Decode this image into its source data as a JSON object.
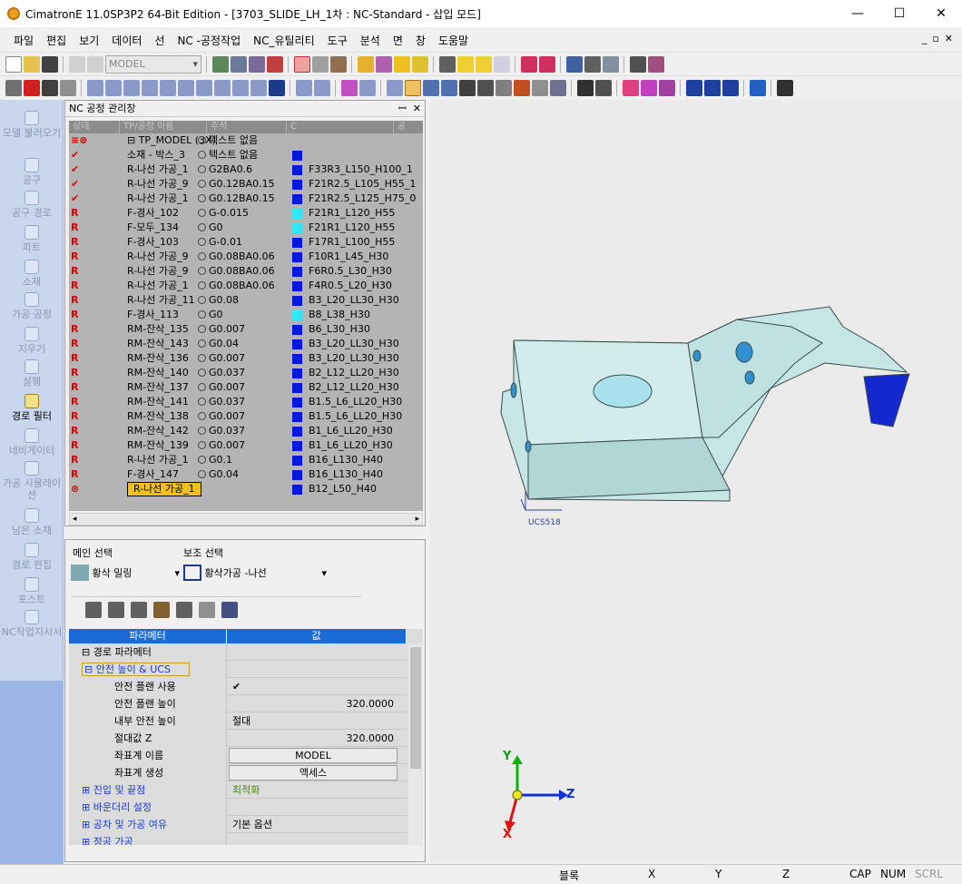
{
  "window": {
    "title": "CimatronE 11.0SP3P2 64-Bit Edition - [3703_SLIDE_LH_1차 : NC-Standard - 삽입 모드]",
    "controls": [
      "—",
      "☐",
      "✕"
    ]
  },
  "menu": [
    "파일",
    "편집",
    "보기",
    "데이터",
    "선",
    "NC -공정작업",
    "NC_유틸리티",
    "도구",
    "분석",
    "면",
    "창",
    "도움말"
  ],
  "mdi_controls": [
    "_",
    "▫",
    "✕"
  ],
  "toolbar": {
    "model_combo": "MODEL"
  },
  "sidebar": [
    {
      "label": "모델 불러오기",
      "active": false
    },
    {
      "label": "공구",
      "active": false
    },
    {
      "label": "공구 경로",
      "active": false
    },
    {
      "label": "파트",
      "active": false
    },
    {
      "label": "소재",
      "active": false
    },
    {
      "label": "가공 공정",
      "active": false
    },
    {
      "label": "지우기",
      "active": false
    },
    {
      "label": "실행",
      "active": false
    },
    {
      "label": "경로 필터",
      "active": true
    },
    {
      "label": "네비게이터",
      "active": false
    },
    {
      "label": "가공 시뮬레이션",
      "active": false
    },
    {
      "label": "남은 소재",
      "active": false
    },
    {
      "label": "경로 편집",
      "active": false
    },
    {
      "label": "포스트",
      "active": false
    },
    {
      "label": "NC작업지시서",
      "active": false
    }
  ],
  "nc_panel": {
    "title": "NC 공정 관리창",
    "pin": "ꟷ",
    "close": "✕",
    "columns": [
      "상태",
      "TP/공정 이름",
      "주석",
      "C",
      "공"
    ],
    "rows": [
      {
        "status": "≡⊗",
        "name": "⊟ TP_MODEL (3X)",
        "value": "텍스트 없음",
        "color": "",
        "tool": ""
      },
      {
        "status": "✔",
        "name": "소재 - 박스_3",
        "value": "텍스트 없음",
        "color": "blue",
        "tool": ""
      },
      {
        "status": "✔",
        "name": "R-나선 가공_1",
        "value": "G2BA0.6",
        "color": "blue",
        "tool": "F33R3_L150_H100_1"
      },
      {
        "status": "✔",
        "name": "R-나선 가공_9",
        "value": "G0.12BA0.15",
        "color": "blue",
        "tool": "F21R2.5_L105_H55_1"
      },
      {
        "status": "✔",
        "name": "R-나선 가공_1",
        "value": "G0.12BA0.15",
        "color": "blue",
        "tool": "F21R2.5_L125_H75_0"
      },
      {
        "status": "R",
        "name": "F-경사_102",
        "value": "G-0.015",
        "color": "cyan",
        "tool": "F21R1_L120_H55"
      },
      {
        "status": "R",
        "name": "F-모두_134",
        "value": "G0",
        "color": "cyan",
        "tool": "F21R1_L120_H55"
      },
      {
        "status": "R",
        "name": "F-경사_103",
        "value": "G-0.01",
        "color": "blue",
        "tool": "F17R1_L100_H55"
      },
      {
        "status": "R",
        "name": "R-나선 가공_9",
        "value": "G0.08BA0.06",
        "color": "blue",
        "tool": "F10R1_L45_H30"
      },
      {
        "status": "R",
        "name": "R-나선 가공_9",
        "value": "G0.08BA0.06",
        "color": "blue",
        "tool": "F6R0.5_L30_H30"
      },
      {
        "status": "R",
        "name": "R-나선 가공_1",
        "value": "G0.08BA0.06",
        "color": "blue",
        "tool": "F4R0.5_L20_H30"
      },
      {
        "status": "R",
        "name": "R-나선 가공_11",
        "value": "G0.08",
        "color": "blue",
        "tool": "B3_L20_LL30_H30"
      },
      {
        "status": "R",
        "name": "F-경사_113",
        "value": "G0",
        "color": "cyan",
        "tool": "B8_L38_H30"
      },
      {
        "status": "R",
        "name": "RM-잔삭_135",
        "value": "G0.007",
        "color": "blue",
        "tool": "B6_L30_H30"
      },
      {
        "status": "R",
        "name": "RM-잔삭_143",
        "value": "G0.04",
        "color": "blue",
        "tool": "B3_L20_LL30_H30"
      },
      {
        "status": "R",
        "name": "RM-잔삭_136",
        "value": "G0.007",
        "color": "blue",
        "tool": "B3_L20_LL30_H30"
      },
      {
        "status": "R",
        "name": "RM-잔삭_140",
        "value": "G0.037",
        "color": "blue",
        "tool": "B2_L12_LL20_H30"
      },
      {
        "status": "R",
        "name": "RM-잔삭_137",
        "value": "G0.007",
        "color": "blue",
        "tool": "B2_L12_LL20_H30"
      },
      {
        "status": "R",
        "name": "RM-잔삭_141",
        "value": "G0.037",
        "color": "blue",
        "tool": "B1.5_L6_LL20_H30"
      },
      {
        "status": "R",
        "name": "RM-잔삭_138",
        "value": "G0.007",
        "color": "blue",
        "tool": "B1.5_L6_LL20_H30"
      },
      {
        "status": "R",
        "name": "RM-잔삭_142",
        "value": "G0.037",
        "color": "blue",
        "tool": "B1_L6_LL20_H30"
      },
      {
        "status": "R",
        "name": "RM-잔삭_139",
        "value": "G0.007",
        "color": "blue",
        "tool": "B1_L6_LL20_H30"
      },
      {
        "status": "R",
        "name": "R-나선 가공_1",
        "value": "G0.1",
        "color": "blue",
        "tool": "B16_L130_H40"
      },
      {
        "status": "R",
        "name": "F-경사_147",
        "value": "G0.04",
        "color": "blue",
        "tool": "B16_L130_H40"
      },
      {
        "status": "⊗",
        "name": "R-나선 가공_1",
        "value": "",
        "color": "blue",
        "tool": "B12_L50_H40"
      }
    ]
  },
  "selection": {
    "main_label": "메인 선택",
    "sub_label": "보조 선택",
    "main_value": "황삭 밀링",
    "sub_value": "황삭가공 -나선"
  },
  "params": {
    "col_param": "파라메터",
    "col_value": "값",
    "rows": [
      {
        "name": "⊟ 경로 파라메터",
        "value": ""
      },
      {
        "name": "⊟ 안전 높이 & UCS",
        "value": ""
      },
      {
        "name": "안전 플랜 사용",
        "value": "✔"
      },
      {
        "name": "안전 플랜 높이",
        "value": "320.0000"
      },
      {
        "name": "내부 안전 높이",
        "value": "절대"
      },
      {
        "name": "절대값 Z",
        "value": "320.0000"
      },
      {
        "name": "좌표계 이름",
        "value": "MODEL"
      },
      {
        "name": "좌표계 생성",
        "value": "액세스"
      },
      {
        "name": "⊞ 진입 및 끝점",
        "value": "최적화"
      },
      {
        "name": "⊞ 바운더리 설정",
        "value": ""
      },
      {
        "name": "⊞ 공차 및 가공 여유",
        "value": "기본 옵션"
      },
      {
        "name": "⊞ 정공 가공",
        "value": ""
      }
    ]
  },
  "viewport": {
    "ucs_label": "UCS518",
    "axis_y": "Y",
    "axis_z": "Z",
    "axis_x": "X"
  },
  "status": {
    "block": "블록",
    "x": "X",
    "y": "Y",
    "z": "Z",
    "cap": "CAP",
    "num": "NUM",
    "scrl": "SCRL"
  }
}
